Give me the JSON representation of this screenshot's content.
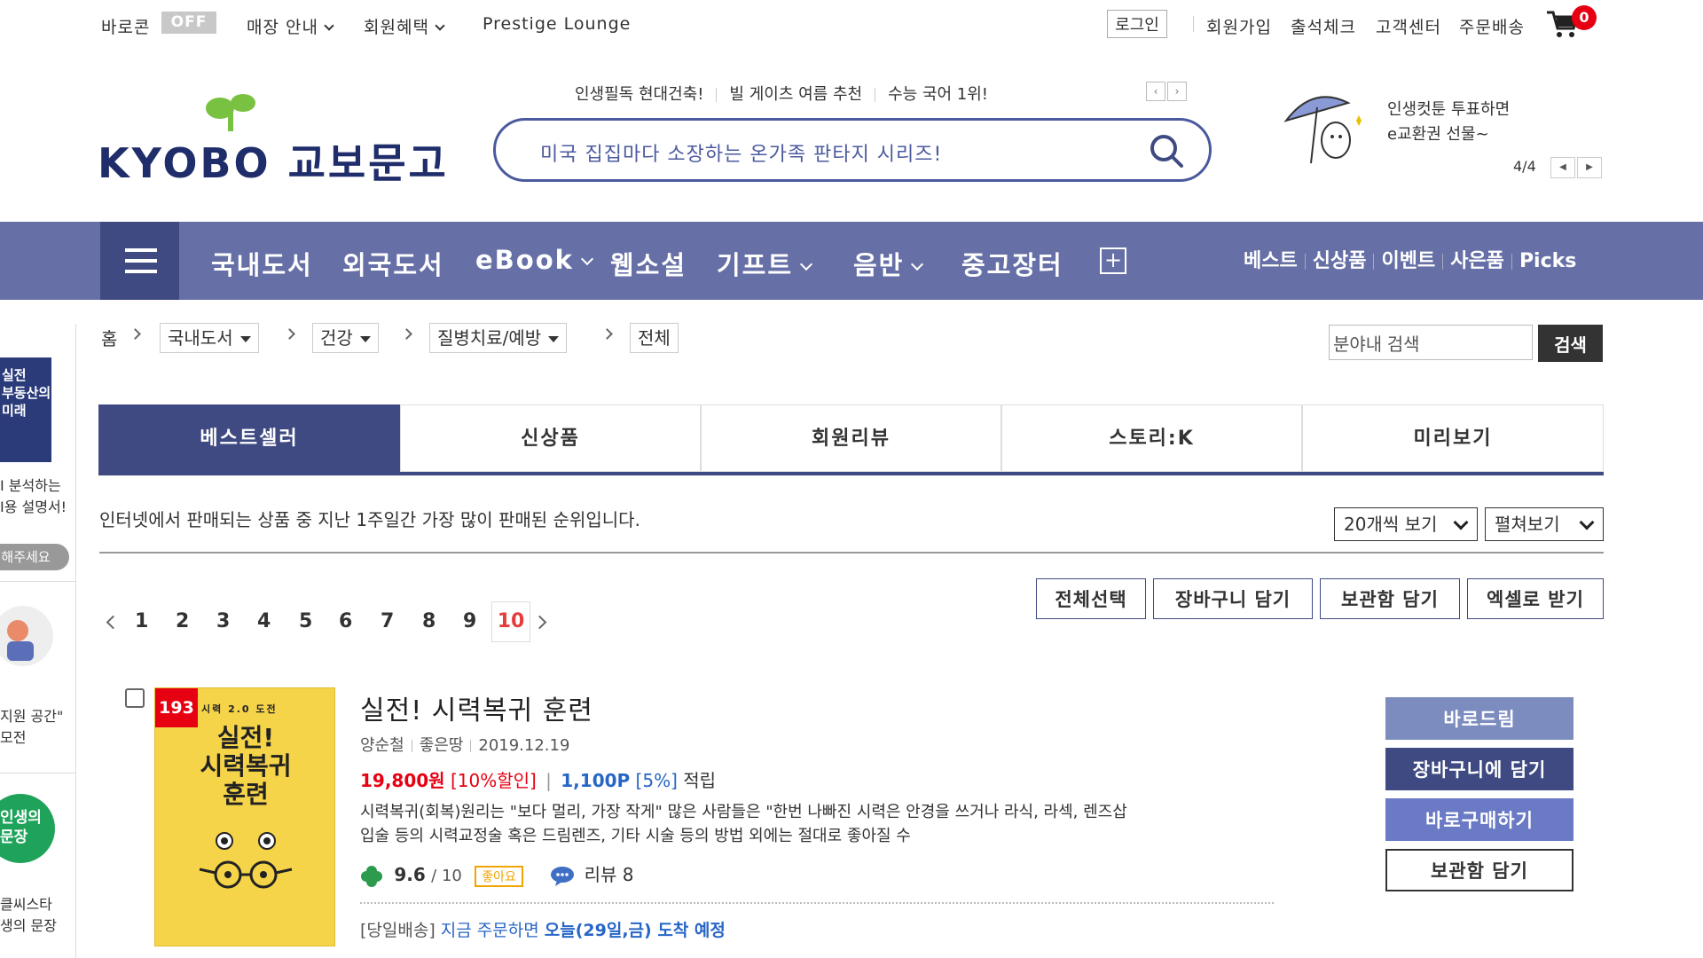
{
  "util": {
    "barodream": "바로콘",
    "off": "OFF",
    "store_info": "매장 안내",
    "benefits": "회원혜택",
    "prestige": "Prestige Lounge",
    "login": "로그인",
    "join": "회원가입",
    "attendance": "출석체크",
    "customer": "고객센터",
    "order_ship": "주문배송",
    "cart_count": "0"
  },
  "header": {
    "logo_text": "KYOBO 교보문고",
    "promos": [
      "인생필독 현대건축!",
      "빌 게이츠 여름 추천",
      "수능 국어 1위!"
    ],
    "search_placeholder": "미국 집집마다 소장하는 온가족 판타지 시리즈!",
    "banner_line1": "인생컷툰 투표하면",
    "banner_line2": "e교환권 선물~",
    "banner_count": "4/4"
  },
  "gnb": {
    "items": [
      "국내도서",
      "외국도서",
      "eBook",
      "웹소설",
      "기프트",
      "음반",
      "중고장터"
    ],
    "right": [
      "베스트",
      "신상품",
      "이벤트",
      "사은품",
      "Picks"
    ]
  },
  "sidebar": {
    "t1a": "I 분석하는",
    "t1b": "I용 설명서!",
    "pill": "해주세요",
    "t2a": "지원 공간\"",
    "t2b": "모전",
    "t3a": "클씨스타",
    "t3b": "생의 문장",
    "cover1": "실전\n부동산의\n미래",
    "circle": "인생의\n문장"
  },
  "breadcrumb": {
    "home": "홈",
    "cat1": "국내도서",
    "cat2": "건강",
    "cat3": "질병치료/예방",
    "cat4": "전체",
    "search_value": "분야내 검색",
    "search_btn": "검색"
  },
  "tabs": [
    "베스트셀러",
    "신상품",
    "회원리뷰",
    "스토리:K",
    "미리보기"
  ],
  "list": {
    "description": "인터넷에서 판매되는 상품 중 지난 1주일간 가장 많이 판매된 순위입니다.",
    "per_page": "20개씩 보기",
    "view_mode": "펼쳐보기",
    "pages": [
      "1",
      "2",
      "3",
      "4",
      "5",
      "6",
      "7",
      "8",
      "9"
    ],
    "current_page": "10",
    "actions": [
      "전체선택",
      "장바구니 담기",
      "보관함 담기",
      "엑셀로 받기"
    ]
  },
  "product": {
    "rank": "193",
    "cover_sub": "시력 2.0 도전",
    "cover_title_1": "실전!",
    "cover_title_2": "시력복귀",
    "cover_title_3": "훈련",
    "title": "실전! 시력복귀 훈련",
    "author": "양순철",
    "publisher": "좋은땅",
    "date": "2019.12.19",
    "price": "19,800원",
    "discount": "[10%할인]",
    "points": "1,100P",
    "points_rate": "[5%]",
    "points_label": "적립",
    "desc_line1": "시력복귀(회복)원리는 \"보다 멀리, 가장 작게\" 많은 사람들은 \"한번 나빠진 시력은 안경을 쓰거나 라식, 라섹, 렌즈삽",
    "desc_line2": "입술 등의 시력교정술 혹은 드림렌즈, 기타 시술 등의 방법 외에는 절대로 좋아질 수",
    "rating": "9.6",
    "rating_max": "/ 10",
    "good": "좋아요",
    "review": "리뷰 8",
    "ship_prefix": "[당일배송]",
    "ship_mid": "지금 주문하면",
    "ship_date": "오늘(29일,금) 도착 예정",
    "btn_barodream": "바로드림",
    "btn_cart": "장바구니에 담기",
    "btn_buy": "바로구매하기",
    "btn_wish": "보관함 담기"
  },
  "colors": {
    "brand": "#3f4a82",
    "gnb": "#6670a6",
    "accent_red": "#e60012",
    "link_blue": "#2766c6"
  }
}
